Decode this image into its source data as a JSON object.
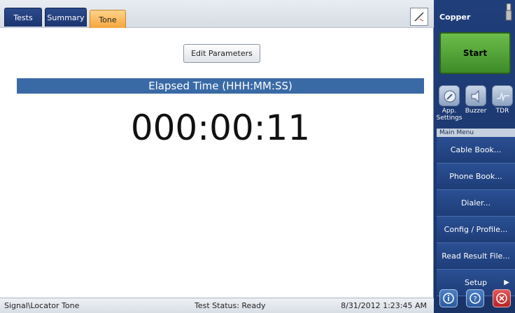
{
  "tabs": [
    {
      "label": "Tests",
      "active": false
    },
    {
      "label": "Summary",
      "active": false
    },
    {
      "label": "Tone",
      "active": true
    }
  ],
  "toolbar": {
    "tool_icon": "pencil-slash-icon"
  },
  "main": {
    "edit_button": "Edit Parameters",
    "elapsed_title": "Elapsed Time (HHH:MM:SS)",
    "elapsed_value": "000:00:11"
  },
  "status": {
    "left": "Signal\\Locator Tone",
    "middle": "Test Status: Ready",
    "right": "8/31/2012 1:23:45 AM"
  },
  "side": {
    "title": "Copper",
    "start_label": "Start",
    "quick": [
      {
        "label": "App. Settings",
        "icon": "wrench-icon"
      },
      {
        "label": "Buzzer",
        "icon": "speaker-icon"
      },
      {
        "label": "TDR",
        "icon": "waveform-icon"
      }
    ],
    "menu_head": "Main Menu",
    "menu": [
      {
        "label": "Cable Book..."
      },
      {
        "label": "Phone Book..."
      },
      {
        "label": "Dialer..."
      },
      {
        "label": "Config / Profile..."
      },
      {
        "label": "Read Result File..."
      },
      {
        "label": "Setup"
      }
    ],
    "bottom_icons": [
      "info-icon",
      "help-icon",
      "close-icon"
    ]
  },
  "colors": {
    "accent_blue": "#3a6aa5",
    "start_green": "#4f9e34",
    "active_tab": "#f4a63c",
    "side_bg": "#1f3e7a"
  }
}
